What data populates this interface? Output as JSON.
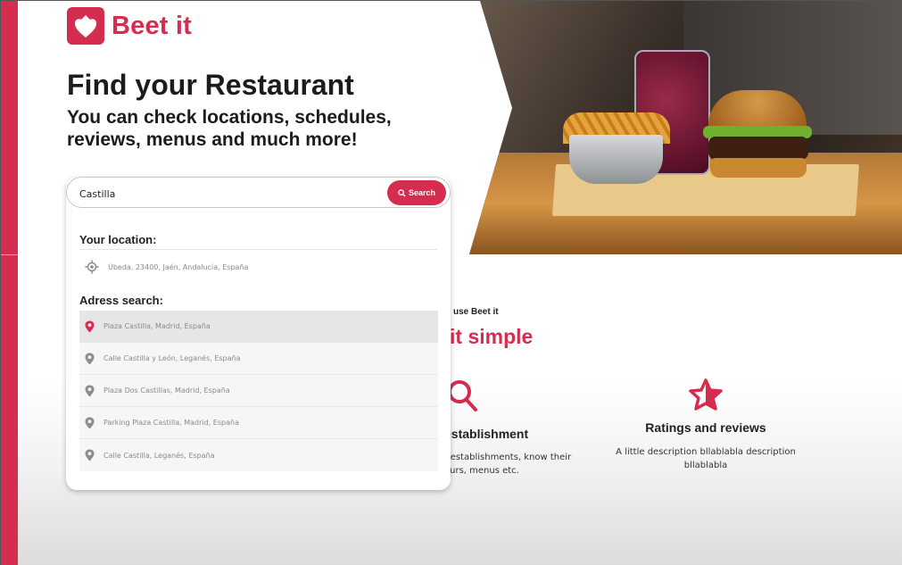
{
  "brand": {
    "name": "Beet it",
    "color": "#d42d4f"
  },
  "hero": {
    "title": "Find your Restaurant",
    "subtitle": "You can check locations, schedules, reviews, menus and much more!"
  },
  "search": {
    "value": "Castilla",
    "button_label": "Search",
    "location_label": "Your location:",
    "current_location": "Úbeda, 23400, Jaén, Andalucía, España",
    "address_label": "Adress search:",
    "results": [
      "Plaza Castilla, Madrid, España",
      "Calle Castilla y León, Leganés, España",
      "Plaza Dos Castillas, Madrid, España",
      "Parking Plaza Castilla, Madrid, España",
      "Calle Castilla, Leganés, España"
    ]
  },
  "how": {
    "small_heading": "use Beet it",
    "big_heading": "it simple",
    "feature_1": {
      "title": "establishment",
      "desc": "f establishments, know their ours, menus etc."
    },
    "feature_2": {
      "title": "Ratings and reviews",
      "desc": "A little description bllablabla description bllablabla"
    }
  }
}
